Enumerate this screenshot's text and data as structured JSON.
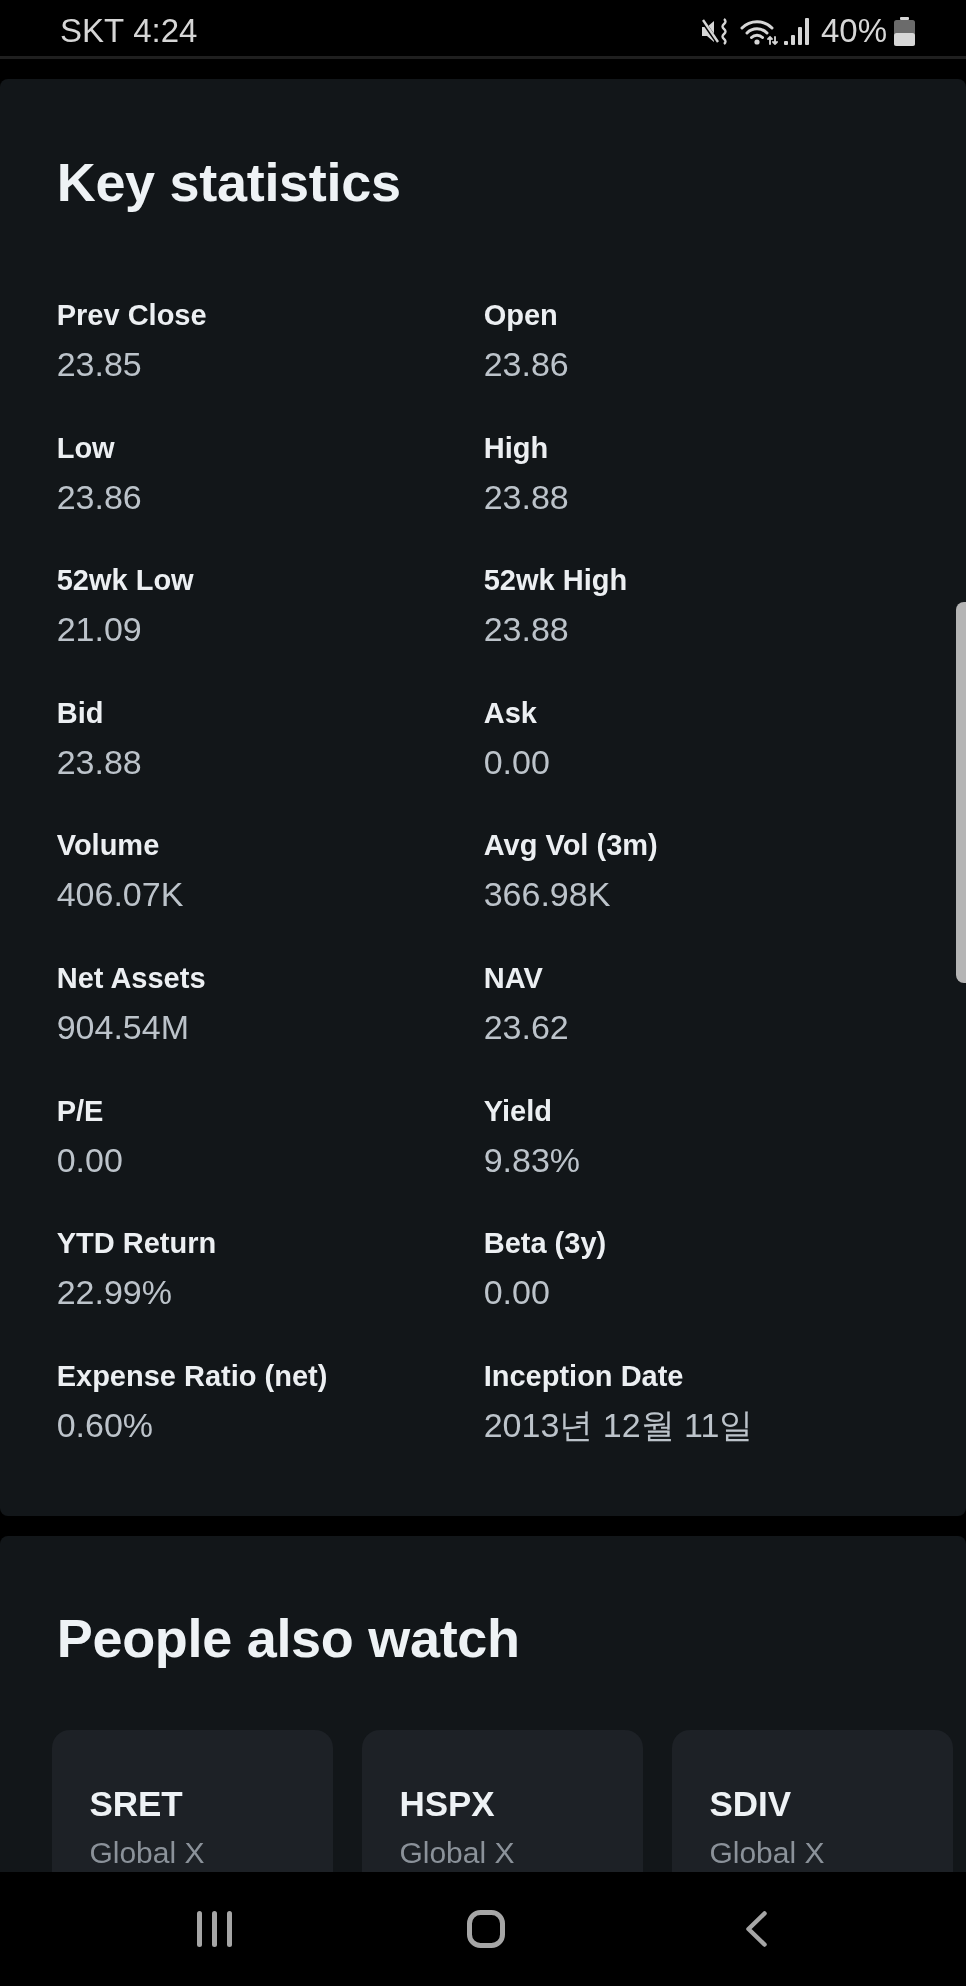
{
  "status_bar": {
    "carrier": "SKT",
    "time": "4:24",
    "battery": "40%"
  },
  "key_statistics": {
    "title": "Key statistics",
    "stats": [
      {
        "label": "Prev Close",
        "value": "23.85"
      },
      {
        "label": "Open",
        "value": "23.86"
      },
      {
        "label": "Low",
        "value": "23.86"
      },
      {
        "label": "High",
        "value": "23.88"
      },
      {
        "label": "52wk Low",
        "value": "21.09"
      },
      {
        "label": "52wk High",
        "value": "23.88"
      },
      {
        "label": "Bid",
        "value": "23.88"
      },
      {
        "label": "Ask",
        "value": "0.00"
      },
      {
        "label": "Volume",
        "value": "406.07K"
      },
      {
        "label": "Avg Vol (3m)",
        "value": "366.98K"
      },
      {
        "label": "Net Assets",
        "value": "904.54M"
      },
      {
        "label": "NAV",
        "value": "23.62"
      },
      {
        "label": "P/E",
        "value": "0.00"
      },
      {
        "label": "Yield",
        "value": "9.83%"
      },
      {
        "label": "YTD Return",
        "value": "22.99%"
      },
      {
        "label": "Beta (3y)",
        "value": "0.00"
      },
      {
        "label": "Expense Ratio (net)",
        "value": "0.60%"
      },
      {
        "label": "Inception Date",
        "value": "2013년 12월 11일"
      }
    ]
  },
  "people_also_watch": {
    "title": "People also watch",
    "tickers": [
      {
        "symbol": "SRET",
        "issuer": "Global X"
      },
      {
        "symbol": "HSPX",
        "issuer": "Global X"
      },
      {
        "symbol": "SDIV",
        "issuer": "Global X"
      }
    ]
  }
}
